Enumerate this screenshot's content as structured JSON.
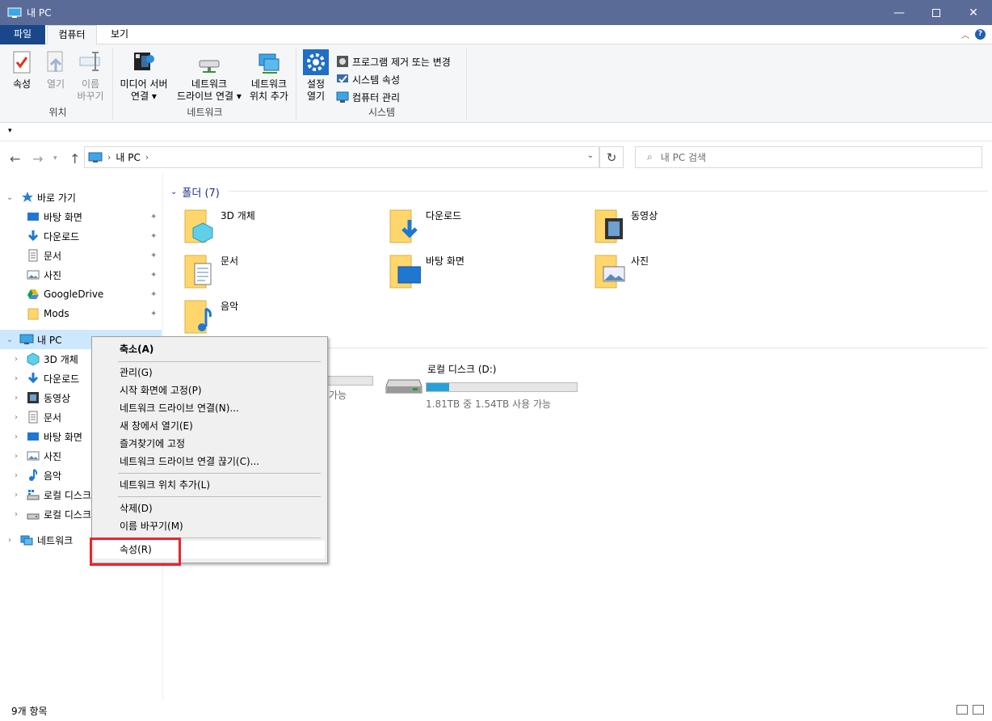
{
  "window": {
    "title": "내 PC"
  },
  "ribbon_tabs": {
    "file": "파일",
    "computer": "컴퓨터",
    "view": "보기"
  },
  "ribbon": {
    "location_group": {
      "label": "위치",
      "properties": "속성",
      "open": "열기",
      "rename_1": "이름",
      "rename_2": "바꾸기"
    },
    "network_group": {
      "label": "네트워크",
      "media_1": "미디어 서버",
      "media_2": "연결 ▾",
      "map_1": "네트워크",
      "map_2": "드라이브 연결 ▾",
      "addloc_1": "네트워크",
      "addloc_2": "위치 추가"
    },
    "system_group": {
      "label": "시스템",
      "settings_1": "설정",
      "settings_2": "열기",
      "uninstall": "프로그램 제거 또는 변경",
      "sysprops": "시스템 속성",
      "manage": "컴퓨터 관리"
    }
  },
  "address": {
    "crumb": "내 PC",
    "search_placeholder": "내 PC 검색"
  },
  "nav": {
    "quick_access": "바로 가기",
    "quick_items": [
      "바탕 화면",
      "다운로드",
      "문서",
      "사진",
      "GoogleDrive",
      "Mods"
    ],
    "this_pc": "내 PC",
    "pc_items": [
      "3D 개체",
      "다운로드",
      "동영상",
      "문서",
      "바탕 화면",
      "사진",
      "음악",
      "로컬 디스크",
      "로컬 디스크"
    ],
    "network": "네트워크"
  },
  "content": {
    "folders_header": "폴더 (7)",
    "folders": [
      "3D 개체",
      "다운로드",
      "동영상",
      "문서",
      "바탕 화면",
      "사진",
      "음악"
    ],
    "drive_d": {
      "name": "로컬 디스크 (D:)",
      "free": "1.81TB 중 1.54TB 사용 가능",
      "used_fraction": 0.15
    },
    "drive_c_free_tail": "가능"
  },
  "context_menu": {
    "collapse": "축소(A)",
    "manage": "관리(G)",
    "pin_start": "시작 화면에 고정(P)",
    "map_drive": "네트워크 드라이브 연결(N)...",
    "open_new": "새 창에서 열기(E)",
    "pin_quick": "즐겨찾기에 고정",
    "disconnect": "네트워크 드라이브 연결 끊기(C)...",
    "add_netloc": "네트워크 위치 추가(L)",
    "delete": "삭제(D)",
    "rename": "이름 바꾸기(M)",
    "properties": "속성(R)"
  },
  "status": {
    "count": "9개 항목"
  },
  "colors": {
    "titlebar": "#5b6b97",
    "file_tab": "#19478a",
    "selection": "#cce8ff",
    "drive_bar": "#26a0da",
    "highlight": "#e8262d"
  }
}
